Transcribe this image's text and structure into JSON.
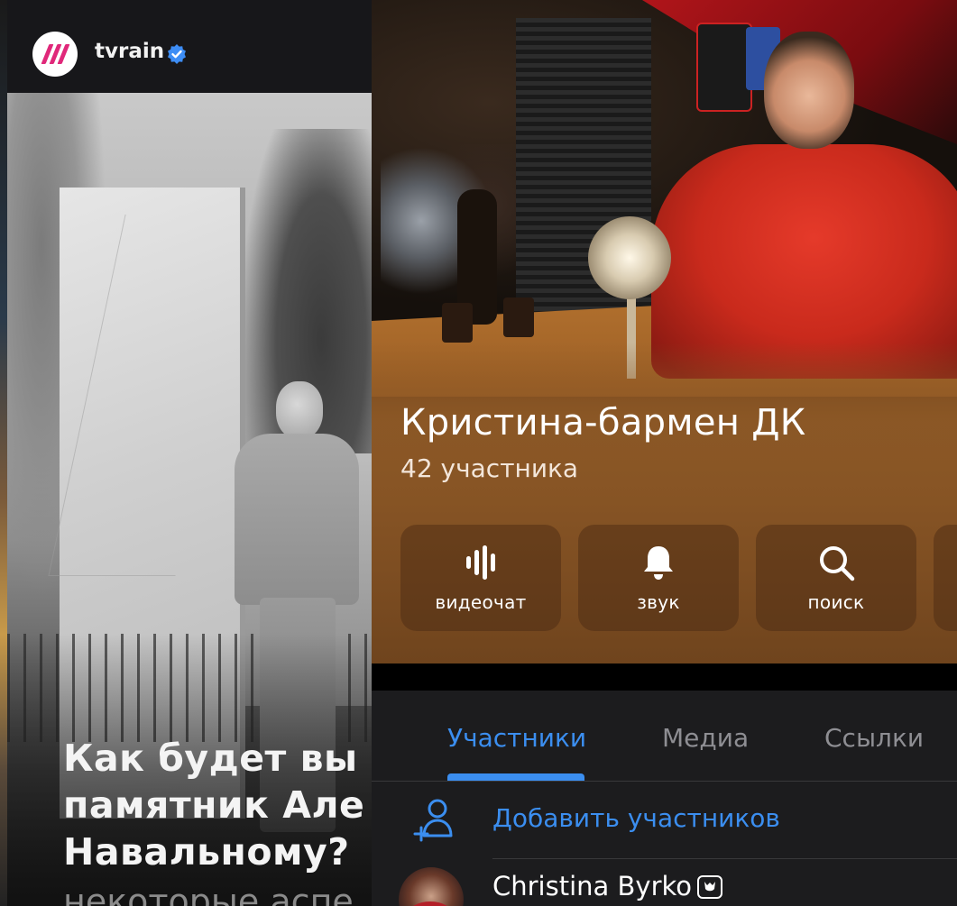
{
  "left_post": {
    "channel_name": "tvrain",
    "headline": "Как будет вы\nпамятник Але\nНавальному?",
    "subline": "некоторые аспе",
    "accent_color": "#e0287a",
    "verified_color": "#3d8df5"
  },
  "chat": {
    "title": "Кристина-бармен ДК",
    "subtitle": "42 участника",
    "actions": [
      {
        "label": "видеочат",
        "icon": "voice-wave-icon"
      },
      {
        "label": "звук",
        "icon": "bell-icon"
      },
      {
        "label": "поиск",
        "icon": "search-icon"
      }
    ],
    "tabs": [
      {
        "label": "Участники",
        "active": true
      },
      {
        "label": "Медиа",
        "active": false
      },
      {
        "label": "Ссылки",
        "active": false
      }
    ],
    "add_members_label": "Добавить участников",
    "members": [
      {
        "name": "Christina Byrko",
        "badge_icon": "emoji-status-icon"
      }
    ],
    "accent_color": "#3b8ef0"
  }
}
